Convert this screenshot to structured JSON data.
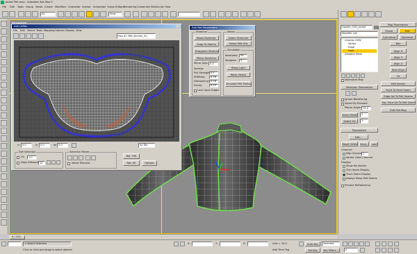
{
  "window": {
    "title": "Jacket Pelt.max - Autodesk 3ds Max 9"
  },
  "menu": [
    "File",
    "Edit",
    "Tools",
    "Group",
    "Views",
    "Create",
    "Modifiers",
    "Character",
    "reactor",
    "Animation",
    "Graph Editors",
    "Rendering",
    "Customize",
    "MAXScript",
    "Help"
  ],
  "toolbar": {
    "selection_filter": "All",
    "view_dropdown": "View",
    "named_selection": ""
  },
  "uvw_editor": {
    "title": "Edit UVWs",
    "menus": [
      "File",
      "Edit",
      "Select",
      "Tools",
      "Mapping",
      "Options",
      "Display",
      "View"
    ],
    "map_dropdown": "Map #1 (Pelt_Shrinkle_01)",
    "u_label": "U:",
    "v_label": "V:",
    "w_label": "W:",
    "u_value": "0.0",
    "v_value": "0.0",
    "w_value": "0.0",
    "all_ids": "All IDs",
    "soft_selection_label": "Soft Selection",
    "on_label": "On",
    "edge_distance_label": "Edge Distance",
    "falloff_value": "10",
    "falloff2_value": "1.0",
    "selection_modes_label": "Selection Modes",
    "select_element_label": "Select Element",
    "rot_label": "Rot +90",
    "rot2_label": "Rot -90",
    "options_label": "Options"
  },
  "pelt_dialog": {
    "title": "Edit Pelt Parameters",
    "stretcher_label": "Stretcher",
    "reset_stretcher": "Reset Stretcher",
    "snap_to_seams": "Snap To Seams",
    "straighten_stretcher": "Straighten Stretcher",
    "mirror_stretcher": "Mirror Stretcher",
    "mirror_axis_label": "Mirror Axis:",
    "mirror_axis_value": "0.0",
    "springs_label": "Springs",
    "pull_strength_label": "Pull Strength:",
    "pull_strength_value": "0.1",
    "stiffness_label": "Stiffness:",
    "stiffness_value": "0.16",
    "dampening_label": "Dampening:",
    "dampening_value": "0.16",
    "decay_label": "Decay:",
    "decay_value": "0.25",
    "lock_open_edges": "Lock Open Edges",
    "select_label": "Select",
    "select_stretcher": "Select Stretcher",
    "select_pelt_uvs": "Select Pelt UVs",
    "simulation_label": "Simulation",
    "iterations_label": "Iterations:",
    "iterations_value": "50",
    "samples_label": "Samples:",
    "samples_value": "5",
    "relax_light": "Relax Light",
    "relax_heavy": "Relax Heavy",
    "simulate_pelt_pulling": "Simulate Pelt Pulling"
  },
  "command_panel": {
    "object_name": "Hoodie_02D_Jacket",
    "modifier_list": "Modifier List",
    "stack": [
      "Unwrap UVW",
      "Vertex",
      "Edge",
      "Face",
      "Editable Mesh"
    ],
    "map_parameters_label": "Map Parameters",
    "planar": "Planar",
    "pelt": "Pelt",
    "cylindrical": "Cylindrical",
    "spherical": "Spherical",
    "box": "Box",
    "align_x": "Align X",
    "align_y": "Align Y",
    "align_z": "Align Z",
    "best_align": "Best Align",
    "fit": "Fit",
    "edit_seams": "Edit Seams",
    "point_to_point_seam": "Point To Point Seam",
    "edge_sel_to_pelt_seams": "Edge Sel To Pelt Seams",
    "exp_face_sel_to_pelt_seams": "Exp. Face Sel To Pelt Seams",
    "edit_pelt_map": "Edit Pelt Map",
    "normalize_map": "Normalize Map",
    "selection_parameters_label": "Selection Parameters",
    "ignore_backfacing": "Ignore Backfacing",
    "select_by_element": "Select By Element",
    "planar_angle_label": "Planar Angle:",
    "planar_angle_value": "15.0",
    "select_mat_id_label": "Select MatID",
    "select_mat_id_value": "1",
    "select_sg_label": "Select SG",
    "select_sg_value": "1",
    "parameters_label": "Parameters",
    "edit": "Edit...",
    "reset_uvws": "Reset UVWs",
    "save": "Save...",
    "load": "Load...",
    "channel_label": "Channel:",
    "map_channel_label": "Map Channel:",
    "map_channel_value": "1",
    "vertex_color_channel": "Vertex Color Channel",
    "display_label": "Display:",
    "show_no_seams": "Show No Seams",
    "thin_seam_display": "Thin Seam Display",
    "thick_seam_display": "Thick Seam Display",
    "always_show_pelt_seams": "Always Show Pelt Seams",
    "prevent_reflattening": "Prevent Reflattening"
  },
  "viewport": {
    "label": "Perspective"
  },
  "status": {
    "objects_selected": "1 Object Selected",
    "prompt": "Click or click-and-drag to select objects",
    "x_label": "X:",
    "y_label": "Y:",
    "z_label": "Z:",
    "x_value": "",
    "y_value": "",
    "z_value": "",
    "grid": "Grid = 10.0",
    "auto_key": "Auto Key",
    "set_key": "Set Key",
    "selected": "Selected",
    "key_filters": "Key Filters...",
    "add_time_tag": "Add Time Tag",
    "frame_counter": "0 / 100",
    "frame_value": "0"
  },
  "colors": {
    "viewport_bg": "#8c8c8c",
    "uv_bg": "#505050",
    "uv_mesh": "#ffffff",
    "seam": "#6ee04a",
    "highlight": "#f6c800",
    "selected_stack": "#f6c800"
  }
}
